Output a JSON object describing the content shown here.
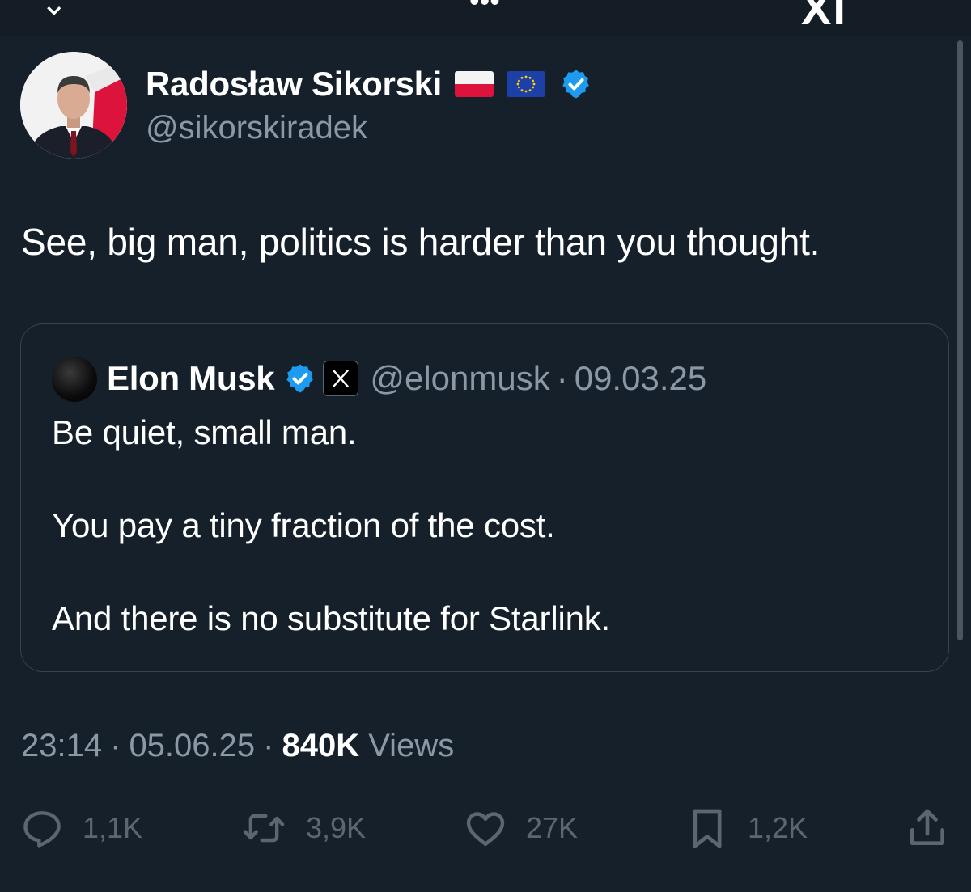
{
  "top_bar": {
    "back_glyph": "⌄",
    "more_glyph": "•••",
    "logo_text": "XI"
  },
  "author": {
    "display_name": "Radosław Sikorski",
    "handle": "@sikorskiradek",
    "badges": [
      "poland-flag",
      "eu-flag",
      "verified-badge"
    ]
  },
  "tweet": {
    "text": "See, big man, politics is harder than you thought."
  },
  "quoted": {
    "display_name": "Elon Musk",
    "handle": "@elonmusk",
    "separator": "·",
    "date": "09.03.25",
    "lines": [
      "Be quiet, small man.",
      "You pay a tiny fraction of the cost.",
      "And there is no substitute for Starlink."
    ]
  },
  "meta": {
    "time": "23:14",
    "separator": "·",
    "date": "05.06.25",
    "views_count": "840K",
    "views_label": "Views"
  },
  "actions": {
    "reply_count": "1,1K",
    "retweet_count": "3,9K",
    "like_count": "27K",
    "bookmark_count": "1,2K"
  },
  "colors": {
    "background": "#15202b",
    "muted": "#8b98a5",
    "border": "#38444d",
    "verified": "#1d9bf0",
    "action_icons": "#5b6670"
  }
}
